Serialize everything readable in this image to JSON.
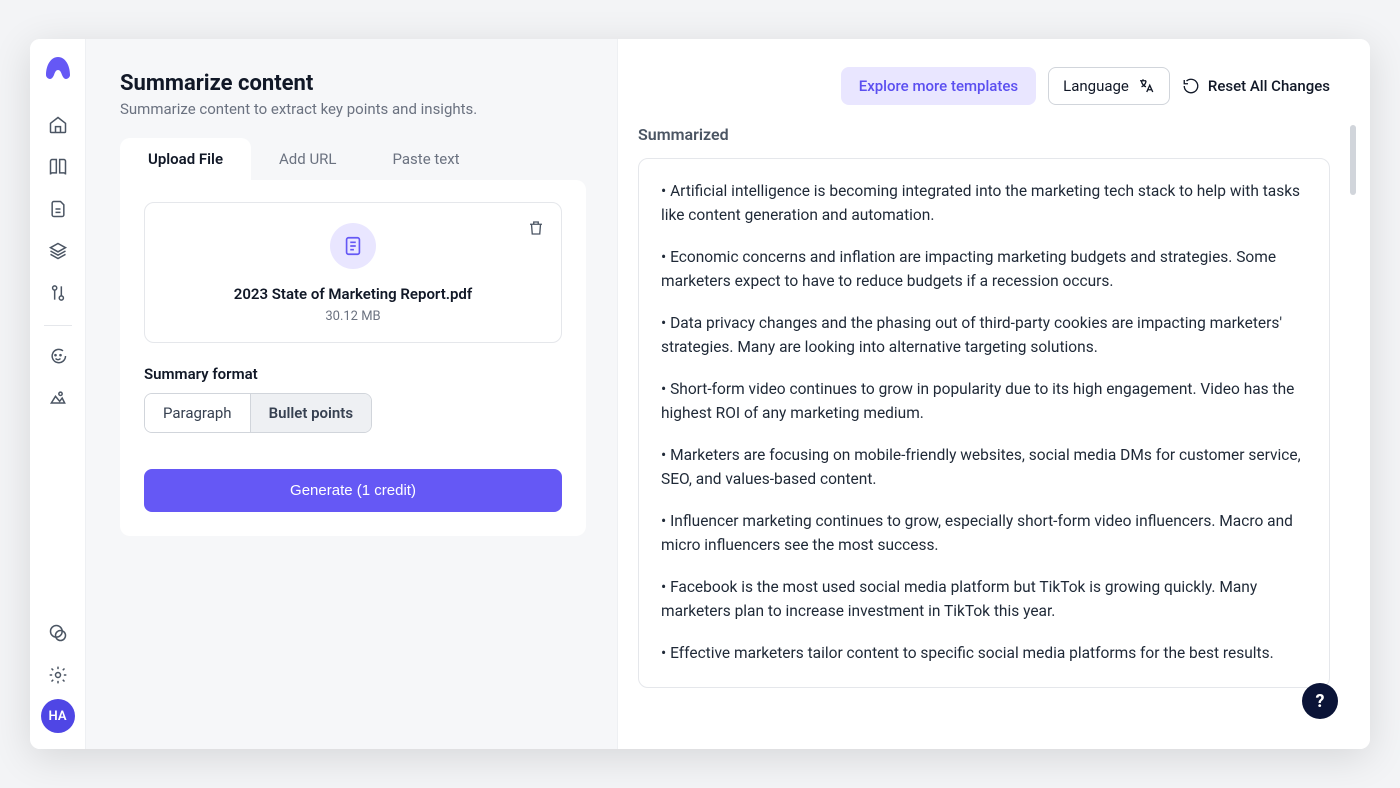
{
  "sidebar": {
    "avatar_initials": "HA"
  },
  "header": {
    "title": "Summarize content",
    "subtitle": "Summarize content to extract key points and insights."
  },
  "tabs": {
    "upload": "Upload File",
    "url": "Add URL",
    "paste": "Paste text"
  },
  "file": {
    "name": "2023 State of Marketing Report.pdf",
    "size": "30.12 MB"
  },
  "format": {
    "label": "Summary format",
    "paragraph": "Paragraph",
    "bullets": "Bullet points"
  },
  "generate_label": "Generate (1 credit)",
  "topbar": {
    "templates": "Explore more templates",
    "language": "Language",
    "reset": "Reset All Changes"
  },
  "output": {
    "title": "Summarized",
    "bullets": [
      "• Artificial intelligence is becoming integrated into the marketing tech stack to help with tasks like content generation and automation.",
      "• Economic concerns and inflation are impacting marketing budgets and strategies. Some marketers expect to have to reduce budgets if a recession occurs.",
      "• Data privacy changes and the phasing out of third-party cookies are impacting marketers' strategies. Many are looking into alternative targeting solutions.",
      "• Short-form video continues to grow in popularity due to its high engagement. Video has the highest ROI of any marketing medium.",
      "• Marketers are focusing on mobile-friendly websites, social media DMs for customer service, SEO, and values-based content.",
      "• Influencer marketing continues to grow, especially short-form video influencers. Macro and micro influencers see the most success.",
      "• Facebook is the most used social media platform but TikTok is growing quickly. Many marketers plan to increase investment in TikTok this year.",
      "• Effective marketers tailor content to specific social media platforms for the best results."
    ]
  },
  "help_fab": "?"
}
